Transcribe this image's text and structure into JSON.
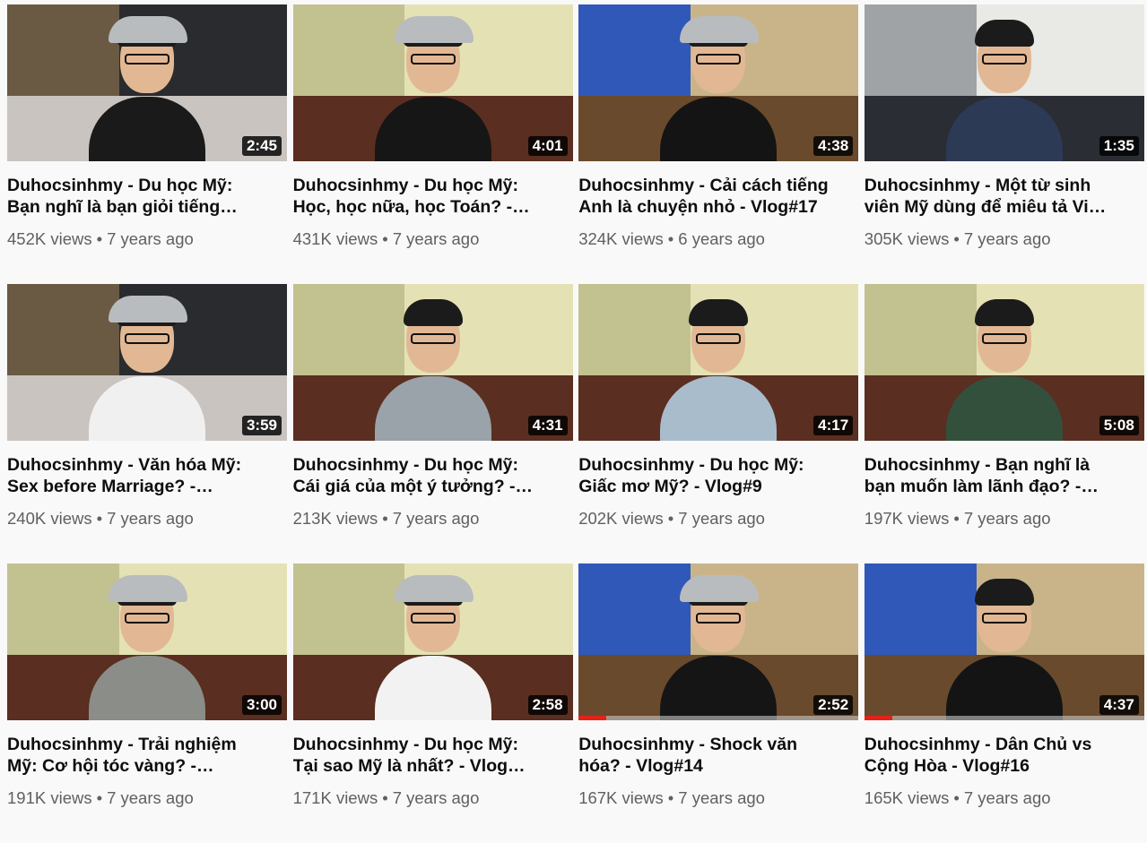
{
  "videos": [
    {
      "title_line1": "Duhocsinhmy - Du học Mỹ:",
      "title_line2": "Bạn nghĩ là bạn giỏi tiếng…",
      "duration": "2:45",
      "views": "452K views",
      "age": "7 years ago",
      "progress": 0,
      "scene": "bedroom",
      "shirt": "#1a1a1a",
      "cap": true
    },
    {
      "title_line1": "Duhocsinhmy - Du học Mỹ:",
      "title_line2": "Học, học nữa, học Toán? -…",
      "duration": "4:01",
      "views": "431K views",
      "age": "7 years ago",
      "progress": 0,
      "scene": "yellow",
      "shirt": "#161616",
      "cap": true
    },
    {
      "title_line1": "Duhocsinhmy - Cải cách tiếng",
      "title_line2": "Anh là chuyện nhỏ - Vlog#17",
      "duration": "4:38",
      "views": "324K views",
      "age": "6 years ago",
      "progress": 0,
      "scene": "blue",
      "shirt": "#141414",
      "cap": true
    },
    {
      "title_line1": "Duhocsinhmy - Một từ sinh",
      "title_line2": "viên Mỹ dùng để miêu tả Vi…",
      "duration": "1:35",
      "views": "305K views",
      "age": "7 years ago",
      "progress": 0,
      "scene": "office",
      "shirt": "#2d3a56",
      "cap": false
    },
    {
      "title_line1": "Duhocsinhmy - Văn hóa Mỹ:",
      "title_line2": "Sex before Marriage? -…",
      "duration": "3:59",
      "views": "240K views",
      "age": "7 years ago",
      "progress": 0,
      "scene": "bedroom",
      "shirt": "#f0f0f0",
      "cap": true
    },
    {
      "title_line1": "Duhocsinhmy - Du học Mỹ:",
      "title_line2": "Cái giá của một ý tưởng? -…",
      "duration": "4:31",
      "views": "213K views",
      "age": "7 years ago",
      "progress": 0,
      "scene": "yellow",
      "shirt": "#9aa2aa",
      "cap": false
    },
    {
      "title_line1": "Duhocsinhmy - Du học Mỹ:",
      "title_line2": "Giấc mơ Mỹ? - Vlog#9",
      "duration": "4:17",
      "views": "202K views",
      "age": "7 years ago",
      "progress": 0,
      "scene": "yellow",
      "shirt": "#a9bccb",
      "cap": false
    },
    {
      "title_line1": "Duhocsinhmy - Bạn nghĩ là",
      "title_line2": "bạn muốn làm lãnh đạo? -…",
      "duration": "5:08",
      "views": "197K views",
      "age": "7 years ago",
      "progress": 0,
      "scene": "yellow",
      "shirt": "#33503d",
      "cap": false
    },
    {
      "title_line1": "Duhocsinhmy - Trải nghiệm",
      "title_line2": "Mỹ: Cơ hội tóc vàng? -…",
      "duration": "3:00",
      "views": "191K views",
      "age": "7 years ago",
      "progress": 0,
      "scene": "yellow",
      "shirt": "#8a8d88",
      "cap": true
    },
    {
      "title_line1": "Duhocsinhmy - Du học Mỹ:",
      "title_line2": "Tại sao Mỹ là nhất? - Vlog…",
      "duration": "2:58",
      "views": "171K views",
      "age": "7 years ago",
      "progress": 0,
      "scene": "yellow",
      "shirt": "#f2f2f2",
      "cap": true
    },
    {
      "title_line1": "Duhocsinhmy - Shock văn",
      "title_line2": "hóa? - Vlog#14",
      "duration": "2:52",
      "views": "167K views",
      "age": "7 years ago",
      "progress": 0.1,
      "scene": "blue",
      "shirt": "#151515",
      "cap": true
    },
    {
      "title_line1": "Duhocsinhmy - Dân Chủ vs",
      "title_line2": "Cộng Hòa - Vlog#16",
      "duration": "4:37",
      "views": "165K views",
      "age": "7 years ago",
      "progress": 0.1,
      "scene": "blue",
      "shirt": "#141414",
      "cap": false
    }
  ],
  "separator": "•",
  "colors": {
    "progress": "#e62117",
    "meta": "#606060",
    "title": "#0d0d0d"
  }
}
